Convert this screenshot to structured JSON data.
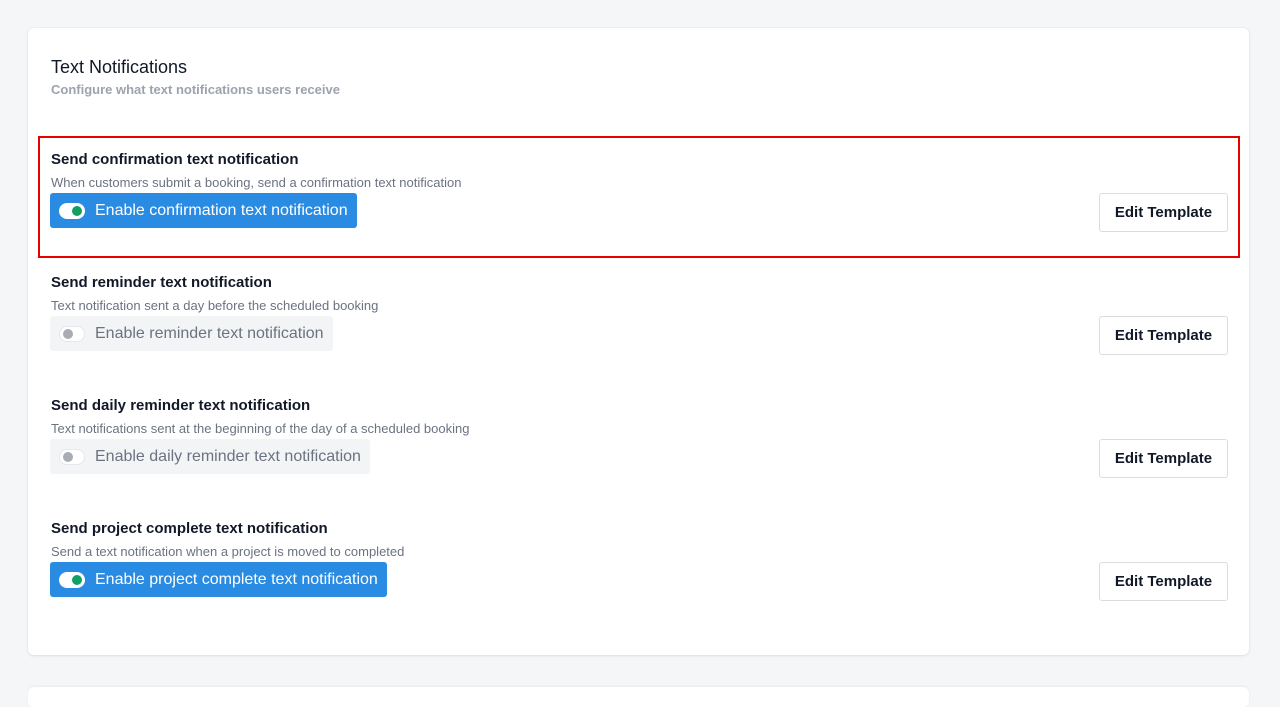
{
  "section": {
    "title": "Text Notifications",
    "subtitle": "Configure what text notifications users receive"
  },
  "notifications": [
    {
      "title": "Send confirmation text notification",
      "description": "When customers submit a booking, send a confirmation text notification",
      "toggle_label": "Enable confirmation text notification",
      "enabled": true,
      "button_label": "Edit Template"
    },
    {
      "title": "Send reminder text notification",
      "description": "Text notification sent a day before the scheduled booking",
      "toggle_label": "Enable reminder text notification",
      "enabled": false,
      "button_label": "Edit Template"
    },
    {
      "title": "Send daily reminder text notification",
      "description": "Text notifications sent at the beginning of the day of a scheduled booking",
      "toggle_label": "Enable daily reminder text notification",
      "enabled": false,
      "button_label": "Edit Template"
    },
    {
      "title": "Send project complete text notification",
      "description": "Send a text notification when a project is moved to completed",
      "toggle_label": "Enable project complete text notification",
      "enabled": true,
      "button_label": "Edit Template"
    }
  ],
  "colors": {
    "accent": "#2a8be3",
    "toggle_on_knob": "#10a064",
    "highlight": "#e60000"
  }
}
